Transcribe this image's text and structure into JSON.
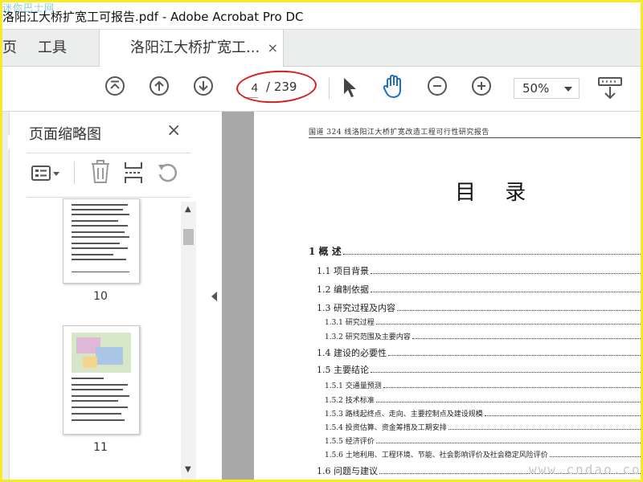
{
  "window": {
    "title": "洛阳江大桥扩宽工可报告.pdf - Adobe Acrobat Pro DC",
    "watermark_top": "迷你巴士网"
  },
  "tabs": [
    {
      "label": "页"
    },
    {
      "label": "工具"
    },
    {
      "label": "洛阳江大桥扩宽工...",
      "close": "×"
    }
  ],
  "toolbar": {
    "icons": [
      "first-page-icon",
      "previous-page-icon",
      "next-page-icon",
      "select-cursor-icon",
      "hand-tool-icon",
      "zoom-out-icon",
      "zoom-in-icon",
      "scroll-mode-icon"
    ],
    "current_page": "4",
    "total_pages": "/ 239",
    "zoom": "50%",
    "annotation_color": "#d81e1e"
  },
  "panel": {
    "title": "页面缩略图",
    "close": "×",
    "tool_icons": [
      "thumbnail-options-icon",
      "delete-icon",
      "split-icon",
      "rotate-icon"
    ],
    "thumbnails": [
      {
        "page": "10"
      },
      {
        "page": "11"
      }
    ]
  },
  "document": {
    "header": "国道 324 线洛阳江大桥扩宽改造工程可行性研究报告",
    "heading": "目   录",
    "toc": [
      {
        "label": "1   概   述",
        "level": 1
      },
      {
        "label": "1.1 项目背景",
        "level": 2
      },
      {
        "label": "1.2 编制依据",
        "level": 2
      },
      {
        "label": "1.3 研究过程及内容",
        "level": 2
      },
      {
        "label": "1.3.1 研究过程",
        "level": 3
      },
      {
        "label": "1.3.2 研究范围及主要内容",
        "level": 3
      },
      {
        "label": "1.4 建设的必要性",
        "level": 2
      },
      {
        "label": "1.5 主要结论",
        "level": 2
      },
      {
        "label": "1.5.1 交通量预测",
        "level": 3
      },
      {
        "label": "1.5.2 技术标准",
        "level": 3
      },
      {
        "label": "1.5.3 路线起终点、走向、主要控制点及建设规模",
        "level": 3
      },
      {
        "label": "1.5.4 投资估算、资金筹措及工期安排",
        "level": 3
      },
      {
        "label": "1.5.5 经济评价",
        "level": 3
      },
      {
        "label": "1.5.6 土地利用、工程环境、节能、社会影响评价及社会稳定风险评价",
        "level": 3
      },
      {
        "label": "1.6 问题与建议",
        "level": 2
      }
    ]
  },
  "watermark_bottom": "www.cndao.com",
  "colors": {
    "frame_border": "#f6ea26",
    "tab_bar": "#eceded",
    "doc_background": "#a8a8a8"
  }
}
